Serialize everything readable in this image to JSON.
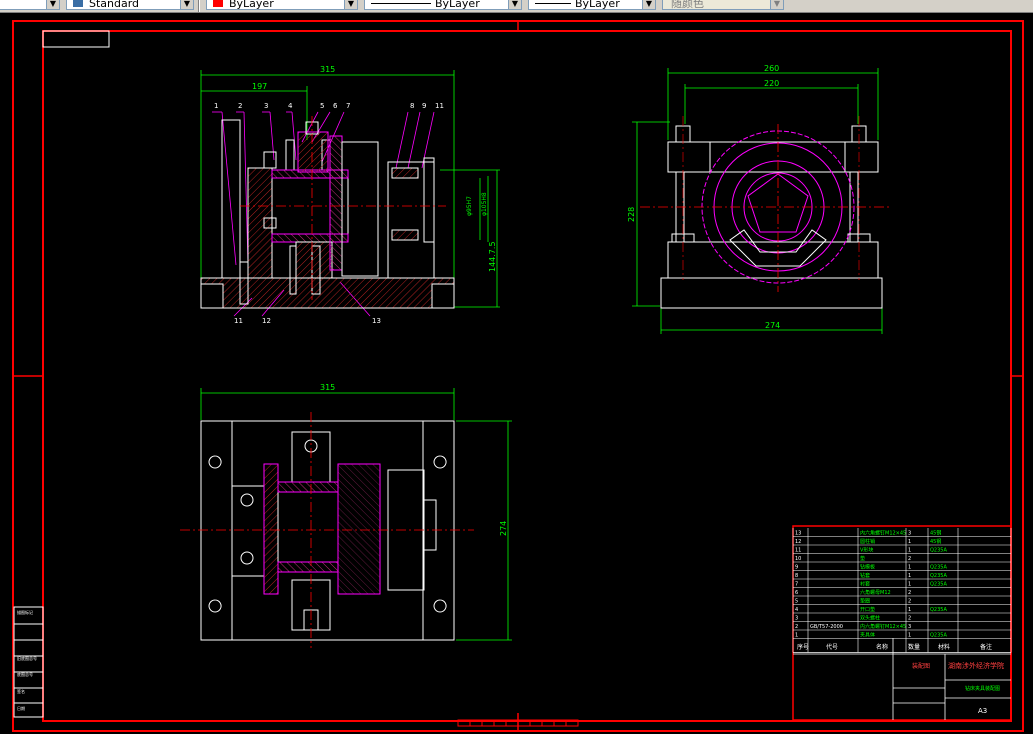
{
  "toolbar": {
    "first_dropdown_value": "",
    "text_style": "Standard",
    "layer_color": "ByLayer",
    "linetype": "ByLayer",
    "lineweight": "ByLayer",
    "plot_style": "随颜色"
  },
  "colors": {
    "border": "#ff0000",
    "dimension": "#00ff00",
    "section": "#ff00ff",
    "hatch": "#b22222",
    "outline": "#ffffff",
    "center": "#ff0000"
  },
  "drawing": {
    "front_view": {
      "dim_width": "315",
      "dim_partial": "197",
      "dim_height": "144.7.5",
      "dim_bore_1": "φ95H7",
      "dim_bore_2": "φ105H8",
      "leaders_top": [
        "1",
        "2",
        "3",
        "4",
        "5",
        "6",
        "7",
        "8",
        "9",
        "11"
      ],
      "leaders_bottom": [
        "11",
        "12",
        "13"
      ]
    },
    "side_view": {
      "dim_outer": "260",
      "dim_inner": "220",
      "dim_height": "228",
      "dim_base": "274"
    },
    "top_view": {
      "dim_width": "315",
      "dim_height": "274"
    }
  },
  "title_block": {
    "bom_rows": [
      {
        "no": "13",
        "code": "",
        "name": "内六角螺钉M12×45",
        "qty": "3",
        "mat": "45钢"
      },
      {
        "no": "12",
        "code": "",
        "name": "圆柱销",
        "qty": "1",
        "mat": "45钢"
      },
      {
        "no": "11",
        "code": "",
        "name": "V形块",
        "qty": "1",
        "mat": "Q235A"
      },
      {
        "no": "10",
        "code": "",
        "name": "垫",
        "qty": "2",
        "mat": ""
      },
      {
        "no": "9",
        "code": "",
        "name": "钻模板",
        "qty": "1",
        "mat": "Q235A"
      },
      {
        "no": "8",
        "code": "",
        "name": "钻套",
        "qty": "1",
        "mat": "Q235A"
      },
      {
        "no": "7",
        "code": "",
        "name": "衬套",
        "qty": "1",
        "mat": "Q235A"
      },
      {
        "no": "6",
        "code": "",
        "name": "六角螺母M12",
        "qty": "2",
        "mat": ""
      },
      {
        "no": "5",
        "code": "",
        "name": "垫圈",
        "qty": "2",
        "mat": ""
      },
      {
        "no": "4",
        "code": "",
        "name": "开口垫",
        "qty": "1",
        "mat": "Q235A"
      },
      {
        "no": "3",
        "code": "",
        "name": "双头螺柱",
        "qty": "2",
        "mat": ""
      },
      {
        "no": "2",
        "code": "GB/T57-2000",
        "name": "内六角螺钉M12×45",
        "qty": "3",
        "mat": ""
      },
      {
        "no": "1",
        "code": "",
        "name": "夹具体",
        "qty": "1",
        "mat": "Q235A"
      }
    ],
    "header": {
      "no": "序号",
      "code": "代号",
      "name": "名称",
      "qty": "数量",
      "mat": "材料",
      "note": "备注"
    },
    "school": "湖南涉外经济学院",
    "drawing_name": "钻床夹具装配图",
    "title_label": "装配图",
    "sheet_size": "A3",
    "left_labels": [
      "描图标记",
      "旧底图总号",
      "底图总号",
      "签名",
      "日期"
    ]
  }
}
